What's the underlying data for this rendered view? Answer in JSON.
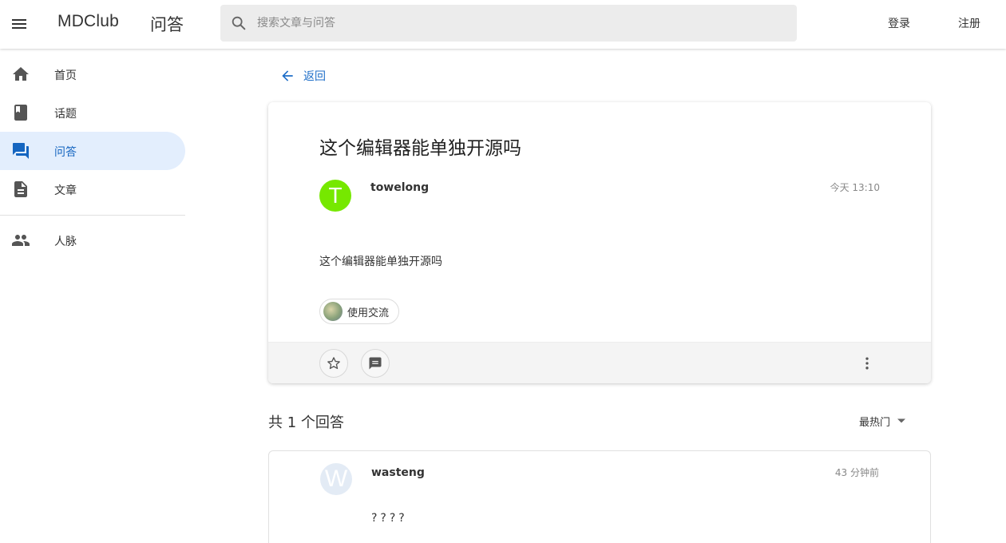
{
  "header": {
    "brand": "MDClub",
    "section": "问答",
    "search_placeholder": "搜索文章与问答",
    "login_label": "登录",
    "register_label": "注册"
  },
  "sidebar": {
    "items": [
      {
        "label": "首页",
        "icon": "home-icon"
      },
      {
        "label": "话题",
        "icon": "book-icon"
      },
      {
        "label": "问答",
        "icon": "forum-icon",
        "active": true
      },
      {
        "label": "文章",
        "icon": "description-icon"
      },
      {
        "label": "人脉",
        "icon": "people-icon"
      }
    ]
  },
  "main": {
    "back_label": "返回",
    "question": {
      "title": "这个编辑器能单独开源吗",
      "author_initial": "T",
      "author": "towelong",
      "time": "今天 13:10",
      "body": "这个编辑器能单独开源吗",
      "topic": "使用交流"
    },
    "answers_count": "共 1 个回答",
    "sort_label": "最热门",
    "answer": {
      "author_initial": "W",
      "author": "wasteng",
      "time": "43 分钟前",
      "body": "????"
    }
  },
  "colors": {
    "accent": "#1e6ec8",
    "active_nav_bg": "#e3eefd",
    "avatar_towelong": "#76e800",
    "avatar_wasteng": "#e3ebf5"
  }
}
